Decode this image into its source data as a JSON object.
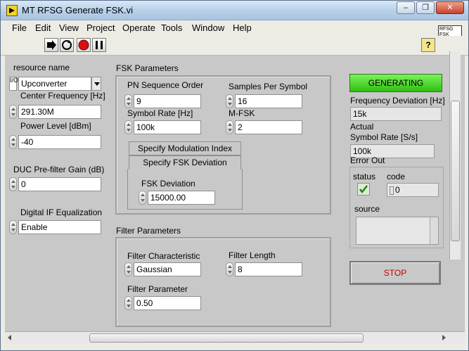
{
  "window": {
    "title": "MT RFSG Generate FSK.vi",
    "min": "–",
    "restore": "❐",
    "close": "✕"
  },
  "menu": [
    {
      "label": "File"
    },
    {
      "label": "Edit"
    },
    {
      "label": "View"
    },
    {
      "label": "Project"
    },
    {
      "label": "Operate"
    },
    {
      "label": "Tools"
    },
    {
      "label": "Window"
    },
    {
      "label": "Help"
    }
  ],
  "vi_icon": {
    "text": "RFSG FSK"
  },
  "help": {
    "glyph": "?"
  },
  "left": {
    "resource_label": "resource name",
    "resource_value": "Upconverter",
    "center_freq_label": "Center Frequency [Hz]",
    "center_freq_value": "291.30M",
    "power_label": "Power Level [dBm]",
    "power_value": "-40",
    "duc_label": "DUC Pre-filter Gain (dB)",
    "duc_value": "0",
    "dif_label": "Digital IF Equalization",
    "dif_value": "Enable"
  },
  "fsk": {
    "group_label": "FSK  Parameters",
    "pn_label": "PN Sequence Order",
    "pn_value": "9",
    "sps_label": "Samples Per Symbol",
    "sps_value": "16",
    "sr_label": "Symbol Rate [Hz]",
    "sr_value": "100k",
    "mfsk_label": "M-FSK",
    "mfsk_value": "2",
    "tab_mod_index": "Specify Modulation Index",
    "tab_deviation": "Specify FSK Deviation",
    "dev_label": "FSK Deviation",
    "dev_value": "15000.00"
  },
  "filter": {
    "group_label": "Filter Parameters",
    "char_label": "Filter Characteristic",
    "char_value": "Gaussian",
    "len_label": "Filter Length",
    "len_value": "8",
    "param_label": "Filter Parameter",
    "param_value": "0.50"
  },
  "right": {
    "status_button": "GENERATING",
    "freq_dev_label": "Frequency Deviation [Hz]",
    "freq_dev_value": "15k",
    "actual_label_1": "Actual",
    "actual_label_2": "Symbol Rate [S/s]",
    "actual_value": "100k",
    "error_label": "Error Out",
    "status_label": "status",
    "code_label": "code",
    "code_value": "0",
    "source_label": "source",
    "stop_label": "STOP"
  },
  "colors": {
    "generating": "#39c41a",
    "stop_text": "#c40000"
  }
}
